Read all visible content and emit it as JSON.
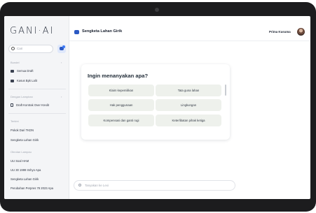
{
  "app": {
    "logo": "GANI·AI"
  },
  "sidebar": {
    "search_placeholder": "Cari",
    "sections": [
      {
        "label": "Bundel",
        "items": [
          "Semua Draft",
          "Kasus Bpk Lalit"
        ]
      },
      {
        "label": "Dengan Lampiran",
        "items": [
          "Draft Kontrak Over Kredit"
        ]
      },
      {
        "label": "Terkini",
        "items": [
          "Pokok Dari TKDN",
          "Sengketa Lahan Girik"
        ]
      },
      {
        "label": "Obrolan Lampau",
        "items": [
          "UU Soal HAM",
          "UU 30 1999 Imhyo Apa",
          "Sengketa Lahan Girik",
          "Perubahan Perpres 78 2023 Apa"
        ]
      }
    ]
  },
  "header": {
    "chat_title": "Sengketa Lahan Girik",
    "user_name": "Prima Kusuma"
  },
  "prompt_card": {
    "title": "Ingin menanyakan apa?",
    "options": [
      "Klaim kepemilikan",
      "Tata guna lahan",
      "Hak penggunaan",
      "Lingkungan",
      "Kompensasi dan ganti rugi",
      "Keterlibatan pihak ketiga"
    ]
  },
  "chat_input": {
    "placeholder": "Tanyakan ke Lexi"
  },
  "colors": {
    "accent": "#2b59c3",
    "option_bg": "#eef1ec",
    "bezel": "#1c1c1e"
  }
}
